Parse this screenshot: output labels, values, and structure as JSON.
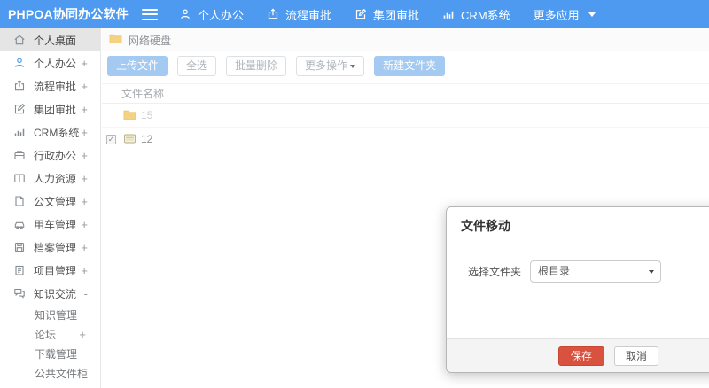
{
  "colors": {
    "topbar_blue": "#4e9af0",
    "primary_light_blue": "#a4caf2",
    "danger_red": "#d9513f",
    "folder_yellow": "#f3d382",
    "active_item_bg": "#e5e5e5"
  },
  "topbar": {
    "logo": "PHPOA协同办公软件",
    "nav": [
      {
        "label": "个人办公",
        "icon": "user-icon"
      },
      {
        "label": "流程审批",
        "icon": "share-icon"
      },
      {
        "label": "集团审批",
        "icon": "edit-icon"
      },
      {
        "label": "CRM系统",
        "icon": "chart-icon"
      },
      {
        "label": "更多应用",
        "icon": "caret-down-icon"
      }
    ]
  },
  "sidebar": {
    "items": [
      {
        "label": "个人桌面",
        "suffix": "",
        "icon": "home-icon",
        "active": true
      },
      {
        "label": "个人办公",
        "suffix": "+",
        "icon": "user-icon"
      },
      {
        "label": "流程审批",
        "suffix": "+",
        "icon": "share-icon"
      },
      {
        "label": "集团审批",
        "suffix": "+",
        "icon": "edit-icon"
      },
      {
        "label": "CRM系统",
        "suffix": "+",
        "icon": "chart-icon"
      },
      {
        "label": "行政办公",
        "suffix": "+",
        "icon": "briefcase-icon"
      },
      {
        "label": "人力资源",
        "suffix": "+",
        "icon": "book-icon"
      },
      {
        "label": "公文管理",
        "suffix": "+",
        "icon": "document-icon"
      },
      {
        "label": "用车管理",
        "suffix": "+",
        "icon": "car-icon"
      },
      {
        "label": "档案管理",
        "suffix": "+",
        "icon": "floppy-icon"
      },
      {
        "label": "项目管理",
        "suffix": "+",
        "icon": "clipboard-icon"
      },
      {
        "label": "知识交流",
        "suffix": "-",
        "icon": "chat-icon"
      }
    ],
    "subitems": [
      {
        "label": "知识管理",
        "suffix": ""
      },
      {
        "label": "论坛",
        "suffix": "+"
      },
      {
        "label": "下载管理",
        "suffix": ""
      },
      {
        "label": "公共文件柜",
        "suffix": ""
      }
    ]
  },
  "breadcrumb": {
    "label": "网络硬盘",
    "icon": "folder-icon"
  },
  "toolbar": {
    "upload": "上传文件",
    "select_all": "全选",
    "batch_delete": "批量删除",
    "more_ops": "更多操作",
    "new_folder": "新建文件夹"
  },
  "table": {
    "header": "文件名称",
    "rows": [
      {
        "name": "15",
        "type": "folder",
        "icon": "folder-icon",
        "checked": false
      },
      {
        "name": "12",
        "type": "disk",
        "icon": "hdd-icon",
        "checked": true
      }
    ]
  },
  "modal": {
    "title": "文件移动",
    "field_label": "选择文件夹",
    "select_value": "根目录",
    "save": "保存",
    "cancel": "取消"
  }
}
